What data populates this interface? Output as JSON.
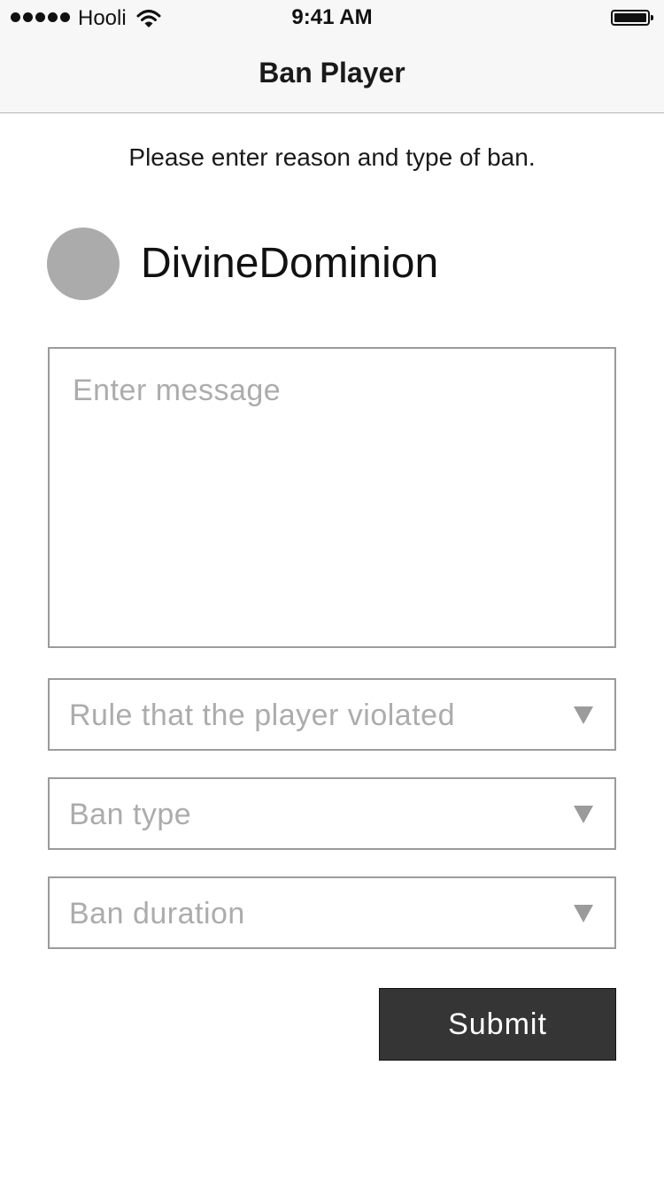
{
  "status_bar": {
    "carrier": "Hooli",
    "time": "9:41 AM",
    "signal_icon": "signal-dots-icon",
    "wifi_icon": "wifi-icon",
    "battery_icon": "battery-icon",
    "battery_level": 1.0
  },
  "nav": {
    "title": "Ban Player"
  },
  "instructions": "Please enter reason and type of ban.",
  "player": {
    "name": "DivineDominion",
    "avatar_color": "#ababab"
  },
  "message": {
    "value": "",
    "placeholder": "Enter message"
  },
  "selects": {
    "rule": {
      "placeholder": "Rule that the player violated",
      "icon": "dropdown-triangle-icon"
    },
    "ban_type": {
      "placeholder": "Ban type",
      "icon": "dropdown-triangle-icon"
    },
    "ban_duration": {
      "placeholder": "Ban duration",
      "icon": "dropdown-triangle-icon"
    }
  },
  "submit_label": "Submit",
  "colors": {
    "button_background": "#353535",
    "border": "#9b9b9b",
    "placeholder_text": "#acacac",
    "bar_background": "#f7f7f7"
  }
}
